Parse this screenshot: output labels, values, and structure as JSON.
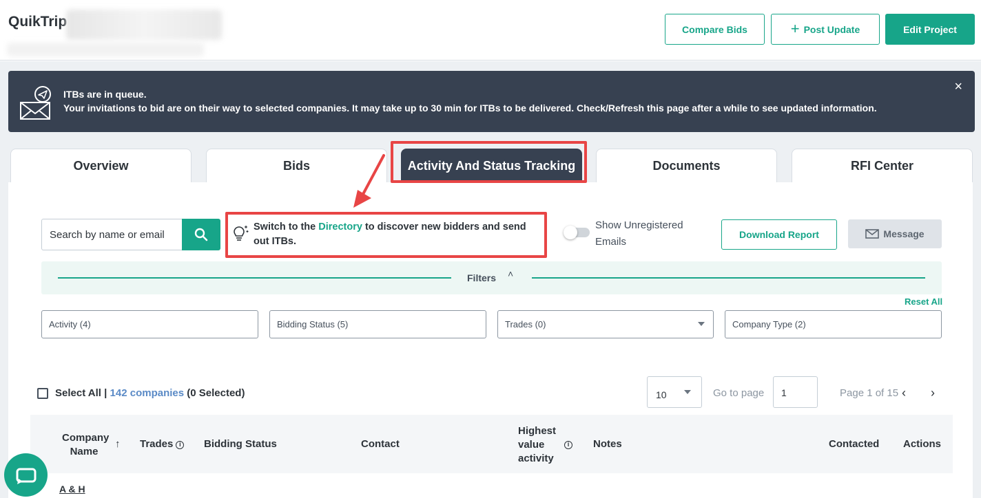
{
  "header": {
    "title": "QuikTrip",
    "compare_bids": "Compare Bids",
    "post_update": "Post Update",
    "edit_project": "Edit Project"
  },
  "banner": {
    "title": "ITBs are in queue.",
    "message": "Your invitations to bid are on their way to selected companies. It may take up to 30 min for ITBs to be delivered. Check/Refresh this page after a while to see updated information.",
    "close": "×"
  },
  "tabs": [
    {
      "label": "Overview"
    },
    {
      "label": "Bids"
    },
    {
      "label": "Activity And Status Tracking",
      "active": true
    },
    {
      "label": "Documents"
    },
    {
      "label": "RFI Center"
    }
  ],
  "toolbar": {
    "search_placeholder": "Search by name or email",
    "tip_prefix": "Switch to the ",
    "tip_link": "Directory",
    "tip_suffix": " to discover new bidders and send out ITBs.",
    "toggle_label": "Show Unregistered Emails",
    "download_report": "Download Report",
    "message": "Message"
  },
  "filters": {
    "label": "Filters",
    "reset_all": "Reset All",
    "activity": "Activity (4)",
    "bidding_status": "Bidding Status (5)",
    "trades": "Trades (0)",
    "company_type": "Company Type (2)"
  },
  "list_controls": {
    "select_all": "Select All",
    "separator": " | ",
    "companies": "142 companies",
    "selected": " (0 Selected)",
    "per_page": "10",
    "goto_label": "Go to page",
    "goto_value": "1",
    "page_of": "Page 1 of 15"
  },
  "table": {
    "columns": {
      "company_name_1": "Company",
      "company_name_2": "Name",
      "trades": "Trades",
      "bidding_status": "Bidding Status",
      "contact": "Contact",
      "highest_1": "Highest",
      "highest_2": "value",
      "highest_3": "activity",
      "notes": "Notes",
      "contacted": "Contacted",
      "actions": "Actions"
    },
    "rows": [
      {
        "company": "A & H"
      }
    ]
  },
  "colors": {
    "accent": "#17a589",
    "banner_bg": "#374151",
    "highlight": "#e84545"
  }
}
